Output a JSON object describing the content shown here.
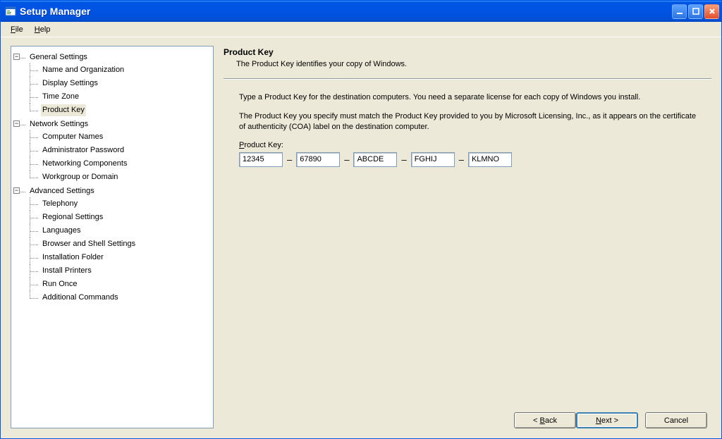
{
  "window": {
    "title": "Setup Manager"
  },
  "menubar": {
    "file": "File",
    "help": "Help"
  },
  "tree": {
    "general": {
      "label": "General Settings",
      "children": {
        "name_org": "Name and Organization",
        "display": "Display Settings",
        "timezone": "Time Zone",
        "product_key": "Product Key"
      }
    },
    "network": {
      "label": "Network Settings",
      "children": {
        "computer_names": "Computer Names",
        "admin_password": "Administrator Password",
        "net_components": "Networking Components",
        "workgroup": "Workgroup or Domain"
      }
    },
    "advanced": {
      "label": "Advanced Settings",
      "children": {
        "telephony": "Telephony",
        "regional": "Regional Settings",
        "languages": "Languages",
        "browser_shell": "Browser and Shell Settings",
        "install_folder": "Installation Folder",
        "install_printers": "Install Printers",
        "run_once": "Run Once",
        "additional_cmds": "Additional Commands"
      }
    }
  },
  "main": {
    "title": "Product Key",
    "description": "The Product Key identifies your copy of Windows.",
    "p1": "Type a Product Key for the destination computers. You need a separate license for each copy of Windows you install.",
    "p2": "The Product Key you specify must match the Product Key provided to you by Microsoft Licensing, Inc., as it appears on the certificate of authenticity (COA) label on the destination computer.",
    "pk_label": "Product Key:",
    "pk_segments": [
      "12345",
      "67890",
      "ABCDE",
      "FGHIJ",
      "KLMNO"
    ]
  },
  "buttons": {
    "back": "< Back",
    "next": "Next >",
    "cancel": "Cancel"
  }
}
